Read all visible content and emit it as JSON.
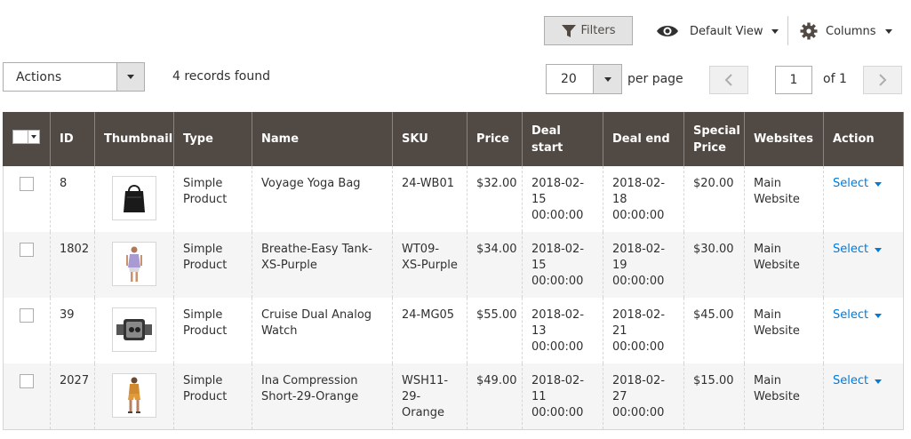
{
  "toolbar": {
    "filters_label": "Filters",
    "view_label": "Default View",
    "columns_label": "Columns"
  },
  "actions": {
    "label": "Actions"
  },
  "records_found": "4 records found",
  "pagination": {
    "per_page_value": "20",
    "per_page_label": "per page",
    "current_page": "1",
    "of_label": "of 1"
  },
  "columns": [
    "ID",
    "Thumbnail",
    "Type",
    "Name",
    "SKU",
    "Price",
    "Deal start",
    "Deal end",
    "Special Price",
    "Websites",
    "Action"
  ],
  "rows": [
    {
      "id": "8",
      "thumb": "bag",
      "type": "Simple Product",
      "name": "Voyage Yoga Bag",
      "sku": "24-WB01",
      "price": "$32.00",
      "deal_start": "2018-02-15 00:00:00",
      "deal_end": "2018-02-18 00:00:00",
      "special_price": "$20.00",
      "websites": "Main Website",
      "action": "Select"
    },
    {
      "id": "1802",
      "thumb": "tank",
      "type": "Simple Product",
      "name": "Breathe-Easy Tank-XS-Purple",
      "sku": "WT09-XS-Purple",
      "price": "$34.00",
      "deal_start": "2018-02-15 00:00:00",
      "deal_end": "2018-02-19 00:00:00",
      "special_price": "$30.00",
      "websites": "Main Website",
      "action": "Select"
    },
    {
      "id": "39",
      "thumb": "watch",
      "type": "Simple Product",
      "name": "Cruise Dual Analog Watch",
      "sku": "24-MG05",
      "price": "$55.00",
      "deal_start": "2018-02-13 00:00:00",
      "deal_end": "2018-02-21 00:00:00",
      "special_price": "$45.00",
      "websites": "Main Website",
      "action": "Select"
    },
    {
      "id": "2027",
      "thumb": "shorts",
      "type": "Simple Product",
      "name": "Ina Compression Short-29-Orange",
      "sku": "WSH11-29-Orange",
      "price": "$49.00",
      "deal_start": "2018-02-11 00:00:00",
      "deal_end": "2018-02-27 00:00:00",
      "special_price": "$15.00",
      "websites": "Main Website",
      "action": "Select"
    }
  ],
  "colors": {
    "header_bg": "#514943",
    "link": "#007bdb",
    "stripe": "#f5f5f5"
  }
}
